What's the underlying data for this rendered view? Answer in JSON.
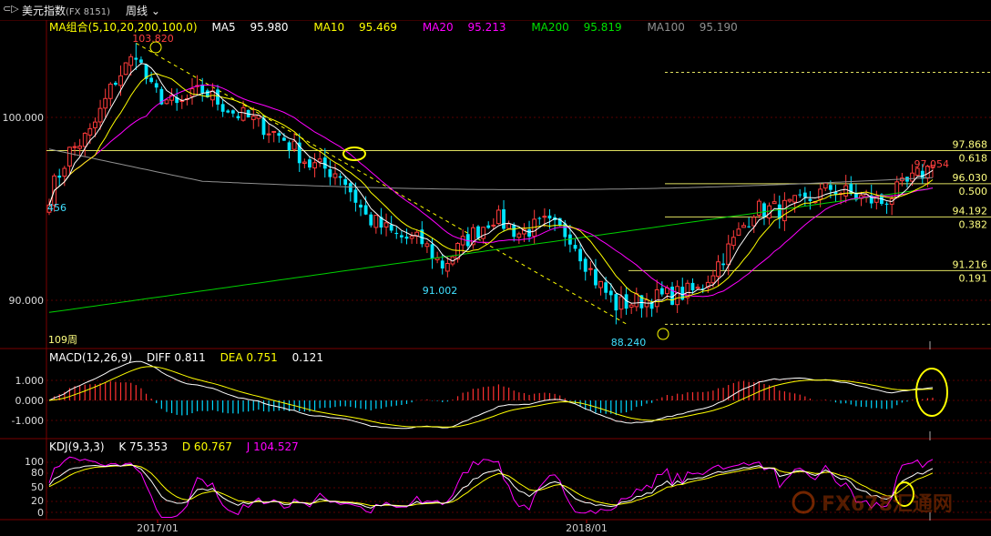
{
  "header": {
    "nav_icon": "back-forward-arrows-icon",
    "nav_glyph": "⊂▷",
    "title": "美元指数",
    "code": "(FX 8151)",
    "period": "周线",
    "period_icon": "chevron-down-icon"
  },
  "ma_legend": {
    "label": "MA组合(5,10,20,200,100,0)",
    "items": [
      {
        "name": "MA5",
        "value": "95.980",
        "color": "#ffffff"
      },
      {
        "name": "MA10",
        "value": "95.469",
        "color": "#ffff00"
      },
      {
        "name": "MA20",
        "value": "95.213",
        "color": "#ff00ff"
      },
      {
        "name": "MA200",
        "value": "95.819",
        "color": "#00e000"
      },
      {
        "name": "MA100",
        "value": "95.190",
        "color": "#909090"
      }
    ]
  },
  "macd_legend": {
    "label": "MACD(12,26,9)",
    "diff": "DIFF 0.811",
    "dea": "DEA 0.751",
    "macd": "0.121"
  },
  "kdj_legend": {
    "label": "KDJ(9,3,3)",
    "k": "K 75.353",
    "d": "D 60.767",
    "j": "J 104.527"
  },
  "annotations": {
    "high": "103.820",
    "low1": "91.002",
    "low2": "88.240",
    "left_label": "456",
    "bars_count": "109周"
  },
  "fib_levels": [
    {
      "price": 97.868,
      "label": "97.868",
      "ratio": "0.618"
    },
    {
      "price": 96.03,
      "label": "96.030",
      "ratio": "0.500"
    },
    {
      "price": 94.192,
      "label": "94.192",
      "ratio": "0.382"
    },
    {
      "price": 91.216,
      "label": "91.216",
      "ratio": "0.191"
    }
  ],
  "last_price": "97.054",
  "watermark": "FX678汇通网",
  "colors": {
    "up": "#ff3b3b",
    "down": "#00e5ff",
    "fib": "#e0e060",
    "grid": "#5a0000",
    "highlight": "#ffff00"
  },
  "chart_data": [
    {
      "type": "candlestick",
      "title": "美元指数 周线",
      "yaxis_ticks": [
        "100.000",
        "90.000"
      ],
      "ylim": [
        86.9,
        105.1
      ],
      "x_ticks": [
        "2017/01",
        "2018/01"
      ],
      "x_tick_index": [
        13,
        96
      ],
      "weeks": 174,
      "close_anchors": [
        [
          0,
          95.4
        ],
        [
          4,
          97.8
        ],
        [
          8,
          98.8
        ],
        [
          13,
          101.8
        ],
        [
          17,
          103.2
        ],
        [
          20,
          101.2
        ],
        [
          25,
          100.3
        ],
        [
          30,
          101.2
        ],
        [
          36,
          100.0
        ],
        [
          41,
          99.4
        ],
        [
          46,
          98.5
        ],
        [
          51,
          97.1
        ],
        [
          57,
          96.6
        ],
        [
          62,
          94.2
        ],
        [
          68,
          93.1
        ],
        [
          73,
          92.8
        ],
        [
          77,
          91.5
        ],
        [
          82,
          93.0
        ],
        [
          87,
          94.2
        ],
        [
          92,
          93.3
        ],
        [
          97,
          93.8
        ],
        [
          102,
          93.2
        ],
        [
          107,
          90.7
        ],
        [
          111,
          89.3
        ],
        [
          115,
          89.5
        ],
        [
          121,
          89.8
        ],
        [
          127,
          90.1
        ],
        [
          133,
          92.4
        ],
        [
          138,
          94.6
        ],
        [
          143,
          94.6
        ],
        [
          148,
          95.0
        ],
        [
          153,
          95.8
        ],
        [
          158,
          95.3
        ],
        [
          163,
          95.0
        ],
        [
          168,
          96.0
        ],
        [
          173,
          97.054
        ]
      ],
      "high_index": 17,
      "low1_index": 77,
      "low2_index": 111
    },
    {
      "type": "line",
      "title": "MACD(12,26,9)",
      "yaxis_ticks": [
        "1.000",
        "0.000",
        "-1.000"
      ],
      "ylim": [
        -2.0,
        2.0
      ],
      "series": [
        {
          "name": "DIFF"
        },
        {
          "name": "DEA"
        },
        {
          "name": "MACD"
        }
      ]
    },
    {
      "type": "line",
      "title": "KDJ(9,3,3)",
      "yaxis_ticks": [
        "100",
        "80",
        "50",
        "20",
        "0"
      ],
      "ylim": [
        -10,
        125
      ],
      "series": [
        {
          "name": "K"
        },
        {
          "name": "D"
        },
        {
          "name": "J"
        }
      ]
    }
  ]
}
